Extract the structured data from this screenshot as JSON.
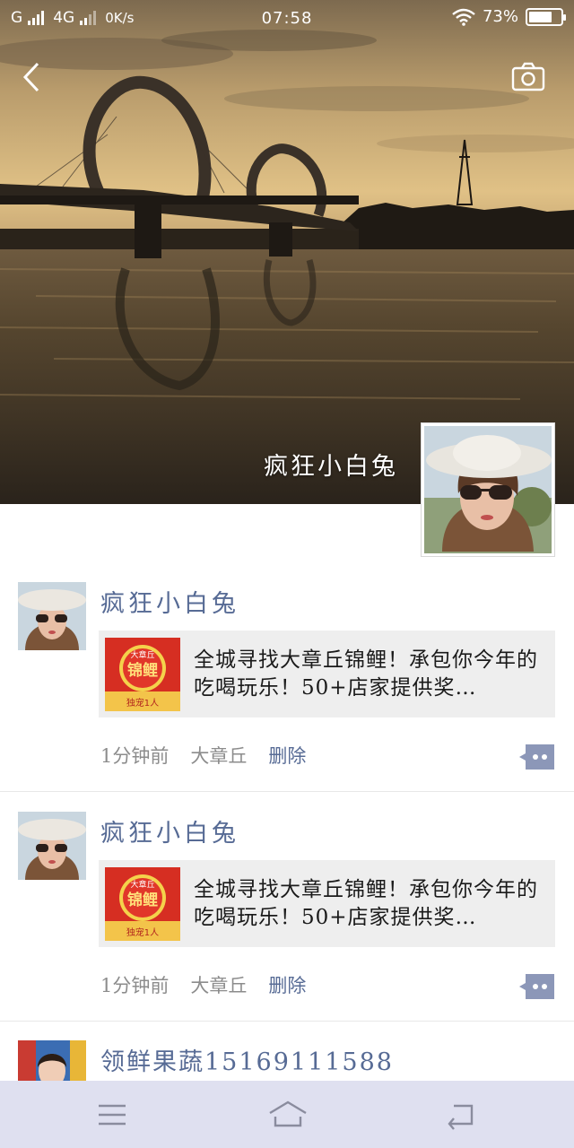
{
  "status_bar": {
    "carrier1": "G",
    "carrier2": "4G",
    "net_speed": "0K/s",
    "time": "07:58",
    "battery_text": "73%",
    "battery_level": 0.73
  },
  "header": {
    "back_icon": "chevron-left-icon",
    "camera_icon": "camera-icon"
  },
  "profile": {
    "name": "疯狂小白兔"
  },
  "posts": [
    {
      "author": "疯狂小白兔",
      "share_text": "全城寻找大章丘锦鲤！承包你今年的吃喝玩乐！50+店家提供奖…",
      "thumb_line1": "大章丘",
      "thumb_line2": "锦鲤",
      "thumb_line3": "独宠1人",
      "time": "1分钟前",
      "location": "大章丘",
      "delete_label": "删除"
    },
    {
      "author": "疯狂小白兔",
      "share_text": "全城寻找大章丘锦鲤！承包你今年的吃喝玩乐！50+店家提供奖…",
      "thumb_line1": "大章丘",
      "thumb_line2": "锦鲤",
      "thumb_line3": "独宠1人",
      "time": "1分钟前",
      "location": "大章丘",
      "delete_label": "删除"
    },
    {
      "author": "领鲜果蔬15169111588"
    }
  ],
  "nav_bar": {
    "menu_icon": "menu-icon",
    "home_icon": "home-icon",
    "back_icon": "return-icon"
  },
  "colors": {
    "link_blue": "#576b95",
    "card_bg": "#eeeeee",
    "nav_bg": "#dfe0f0"
  }
}
